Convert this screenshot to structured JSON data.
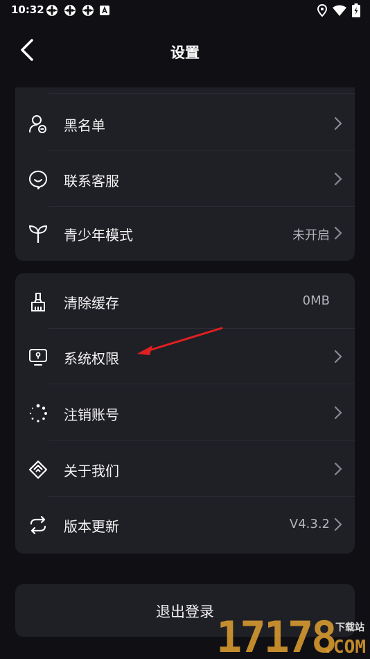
{
  "status_bar": {
    "time": "10:32",
    "left_icons": [
      "notification-icon",
      "notification-icon",
      "notification-icon",
      "a-badge-icon"
    ],
    "right_icons": [
      "location-icon",
      "wifi-icon",
      "battery-icon"
    ]
  },
  "header": {
    "title": "设置"
  },
  "group1": {
    "items": [
      {
        "label": "黑名单",
        "icon": "blacklist-user-icon",
        "value": ""
      },
      {
        "label": "联系客服",
        "icon": "customer-service-icon",
        "value": ""
      },
      {
        "label": "青少年模式",
        "icon": "sprout-icon",
        "value": "未开启"
      }
    ]
  },
  "group2": {
    "items": [
      {
        "label": "清除缓存",
        "icon": "broom-icon",
        "value": "0MB"
      },
      {
        "label": "系统权限",
        "icon": "permission-monitor-icon",
        "value": ""
      },
      {
        "label": "注销账号",
        "icon": "loading-dots-icon",
        "value": ""
      },
      {
        "label": "关于我们",
        "icon": "handshake-icon",
        "value": ""
      },
      {
        "label": "版本更新",
        "icon": "refresh-icon",
        "value": "V4.3.2"
      }
    ]
  },
  "logout": {
    "label": "退出登录"
  },
  "watermark": {
    "digits": "17178",
    "site": "下载站",
    "domain": ".COM"
  },
  "colors": {
    "background": "#101014",
    "card": "#1f1f26",
    "annotation_arrow": "#e02020",
    "watermark": "#e0a030"
  }
}
